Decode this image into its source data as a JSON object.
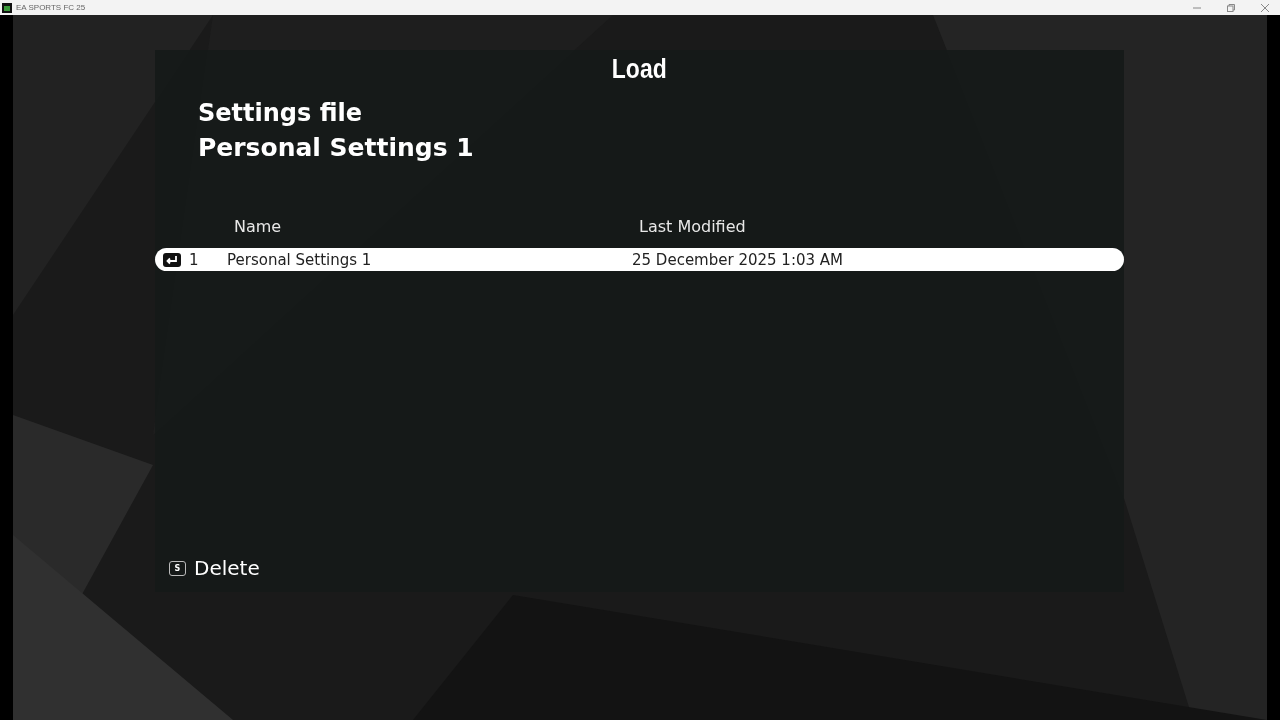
{
  "window": {
    "title": "EA SPORTS FC 25"
  },
  "screen": {
    "title": "Load",
    "section_label": "Settings file",
    "current_file": "Personal Settings 1"
  },
  "table": {
    "columns": [
      "Name",
      "Last Modified"
    ],
    "rows": [
      {
        "index": "1",
        "name": "Personal Settings 1",
        "modified": "25 December 2025 1:03 AM",
        "selected": true
      }
    ]
  },
  "actions": [
    {
      "key": "S",
      "label": "Delete"
    }
  ]
}
